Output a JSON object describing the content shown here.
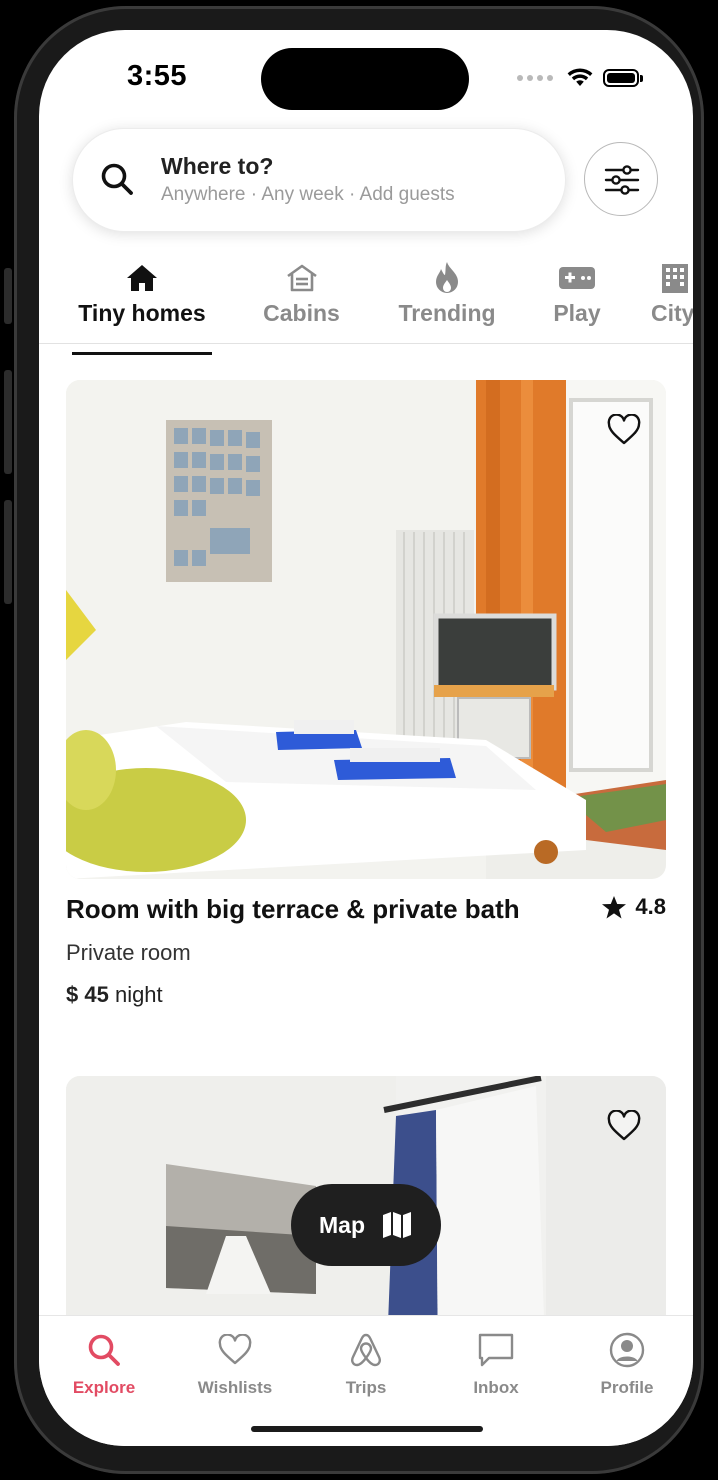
{
  "status": {
    "time": "3:55"
  },
  "search": {
    "title": "Where to?",
    "subtitle": "Anywhere · Any week · Add guests"
  },
  "categories": [
    {
      "label": "Tiny homes",
      "icon": "house-icon",
      "active": true
    },
    {
      "label": "Cabins",
      "icon": "cabin-icon"
    },
    {
      "label": "Trending",
      "icon": "fire-icon"
    },
    {
      "label": "Play",
      "icon": "gamepad-icon"
    },
    {
      "label": "City",
      "icon": "city-icon"
    }
  ],
  "listings": [
    {
      "title": "Room with big terrace & private bath",
      "rating": "4.8",
      "type": "Private room",
      "price": "$ 45",
      "price_unit": "night",
      "favorited": false
    },
    {
      "favorited": false
    }
  ],
  "map_button": {
    "label": "Map"
  },
  "tabbar": [
    {
      "label": "Explore",
      "icon": "search-icon",
      "active": true
    },
    {
      "label": "Wishlists",
      "icon": "heart-icon"
    },
    {
      "label": "Trips",
      "icon": "airbnb-icon"
    },
    {
      "label": "Inbox",
      "icon": "chat-icon"
    },
    {
      "label": "Profile",
      "icon": "profile-icon"
    }
  ],
  "colors": {
    "accent": "#e24b63",
    "text": "#111111",
    "muted": "#8a8a8a"
  }
}
